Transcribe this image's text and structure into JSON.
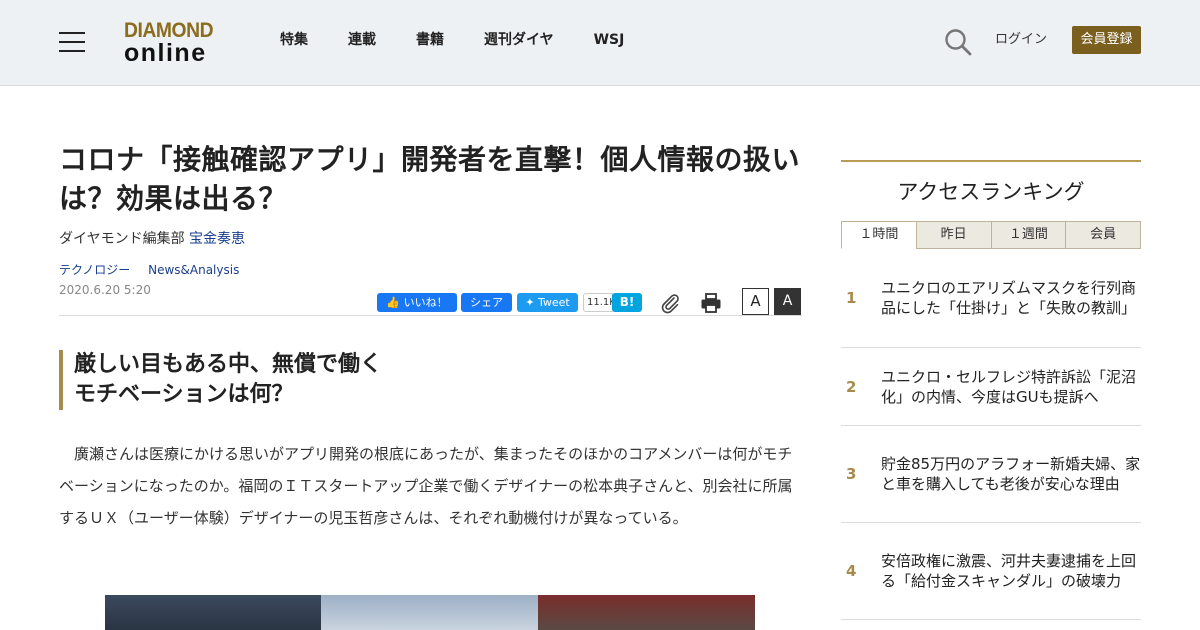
{
  "header": {
    "logo_line1": "DIAMOND",
    "logo_line2": "online",
    "nav": [
      "特集",
      "連載",
      "書籍",
      "週刊ダイヤ",
      "WSJ"
    ],
    "login": "ログイン",
    "register": "会員登録"
  },
  "article": {
    "title": "コロナ「接触確認アプリ」開発者を直撃！個人情報の扱いは？効果は出る？",
    "byline_org": "ダイヤモンド編集部",
    "byline_author": "宝金奏恵",
    "tags": [
      "テクノロジー",
      "News&Analysis"
    ],
    "date": "2020.6.20 5:20",
    "share": {
      "fb_like": "いいね！",
      "fb_share": "シェア",
      "tweet": "Tweet",
      "tweet_count": "11.1K",
      "hatena": "B!"
    },
    "font_small": "A",
    "font_large": "A",
    "subhead_line1": "厳しい目もある中、無償で働く",
    "subhead_line2": "モチベーションは何？",
    "body": "廣瀬さんは医療にかける思いがアプリ開発の根底にあったが、集まったそのほかのコアメンバーは何がモチベーションになったのか。福岡のＩＴスタートアップ企業で働くデザイナーの松本典子さんと、別会社に所属するＵＸ（ユーザー体験）デザイナーの児玉哲彦さんは、それぞれ動機付けが異なっている。"
  },
  "sidebar": {
    "title": "アクセスランキング",
    "tabs": [
      "１時間",
      "昨日",
      "１週間",
      "会員"
    ],
    "active_tab": 0,
    "ranking": [
      {
        "rank": "1",
        "text": "ユニクロのエアリズムマスクを行列商品にした「仕掛け」と「失敗の教訓」"
      },
      {
        "rank": "2",
        "text": "ユニクロ・セルフレジ特許訴訟「泥沼化」の内情、今度はGUも提訴へ"
      },
      {
        "rank": "3",
        "text": "貯金85万円のアラフォー新婚夫婦、家と車を購入しても老後が安心な理由"
      },
      {
        "rank": "4",
        "text": "安倍政権に激震、河井夫妻逮捕を上回る「給付金スキャンダル」の破壊力"
      }
    ]
  },
  "colors": {
    "brand_gold": "#8a6d1e",
    "register_bg": "#7a5f1f",
    "link_blue": "#1a3f8f",
    "rank_gold": "#a68b4c"
  }
}
